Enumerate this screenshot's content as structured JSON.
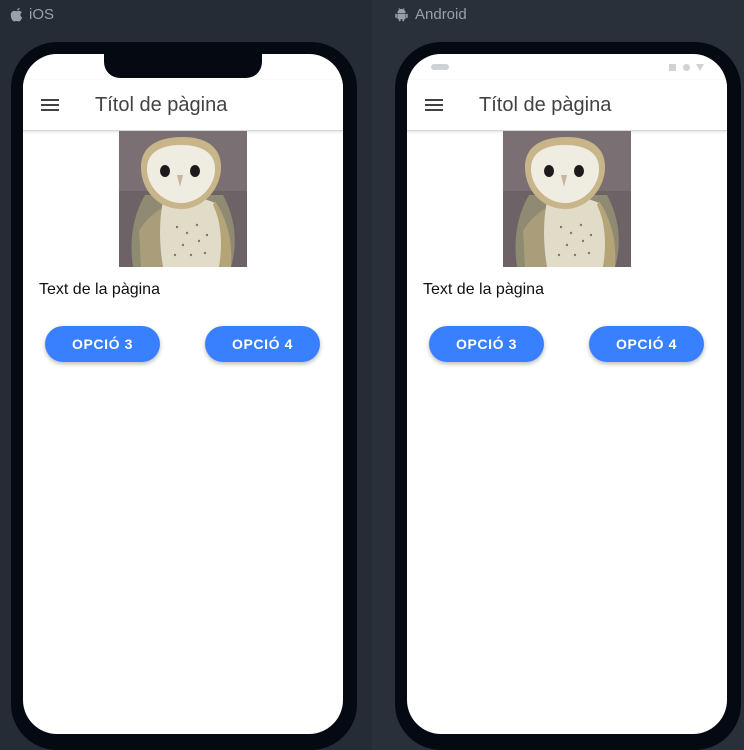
{
  "platforms": [
    {
      "id": "ios",
      "label": "iOS",
      "label_icon": "apple-icon",
      "header": {
        "menu_icon": "menu-icon",
        "title": "Títol de pàgina"
      },
      "content": {
        "image_alt": "owl",
        "text": "Text de la pàgina",
        "buttons": [
          {
            "label": "OPCIÓ 3"
          },
          {
            "label": "OPCIÓ 4"
          }
        ]
      }
    },
    {
      "id": "android",
      "label": "Android",
      "label_icon": "android-icon",
      "header": {
        "menu_icon": "menu-icon",
        "title": "Títol de pàgina"
      },
      "content": {
        "image_alt": "owl",
        "text": "Text de la pàgina",
        "buttons": [
          {
            "label": "OPCIÓ 3"
          },
          {
            "label": "OPCIÓ 4"
          }
        ]
      }
    }
  ],
  "colors": {
    "accent": "#3880ff",
    "background": "#272d37",
    "device_frame": "#050a12",
    "screen": "#ffffff",
    "title_text": "#424242",
    "label_text": "#9aa0a8"
  }
}
